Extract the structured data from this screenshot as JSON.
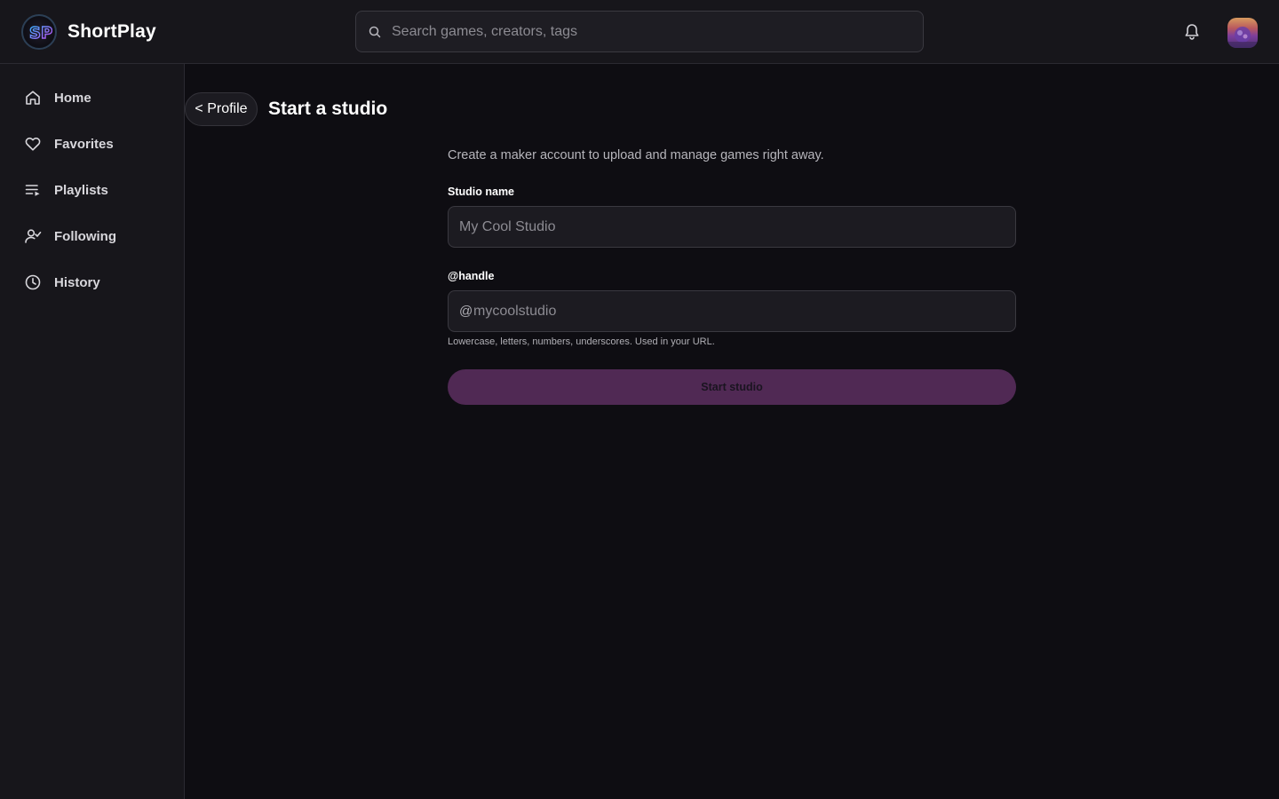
{
  "app": {
    "brand": "ShortPlay",
    "logo_text": "SP",
    "logo_icon": "shortplay-logo-icon"
  },
  "header": {
    "search_placeholder": "Search games, creators, tags",
    "search_icon": "search-icon",
    "notifications_icon": "bell-icon",
    "avatar": "user-avatar"
  },
  "sidebar": {
    "items": [
      {
        "label": "Home",
        "icon": "home-icon"
      },
      {
        "label": "Favorites",
        "icon": "heart-icon"
      },
      {
        "label": "Playlists",
        "icon": "playlist-icon"
      },
      {
        "label": "Following",
        "icon": "following-icon"
      },
      {
        "label": "History",
        "icon": "clock-icon"
      }
    ]
  },
  "page": {
    "back_label": "< Profile",
    "title": "Start a studio",
    "intro": "Create a maker account to upload and manage games right away."
  },
  "form": {
    "studio_name_label": "Studio name",
    "studio_name_placeholder": "My Cool Studio",
    "handle_label": "@handle",
    "handle_prefix": "@",
    "handle_placeholder": "mycoolstudio",
    "handle_hint": "Lowercase, letters, numbers, underscores. Used in your URL.",
    "submit_label": "Start studio",
    "submit_color": "#502954"
  },
  "colors": {
    "background": "#0e0d12",
    "panel": "#17161b",
    "accent": "#502954"
  }
}
